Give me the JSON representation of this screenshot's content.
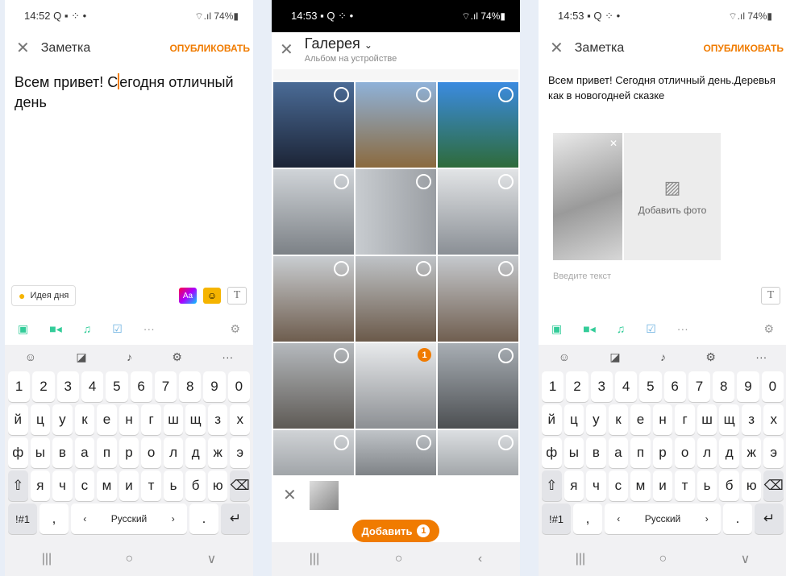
{
  "screens": [
    {
      "status_time": "14:52",
      "status_icons": "Q ▪ ⁘ •",
      "battery": "74%",
      "title": "Заметка",
      "publish": "ОПУБЛИКОВАТЬ",
      "note_before_caret": "Всем привет! С",
      "note_after_caret": "егодня отличный день"
    },
    {
      "status_time": "14:53",
      "status_icons": "▪ Q ⁘ •",
      "battery": "74%",
      "gallery_title": "Галерея",
      "gallery_sub": "Альбом на устройстве",
      "selected_count": "1",
      "add_button": "Добавить"
    },
    {
      "status_time": "14:53",
      "status_icons": "▪ Q ⁘ •",
      "battery": "74%",
      "title": "Заметка",
      "publish": "ОПУБЛИКОВАТЬ",
      "note": "Всем привет! Сегодня отличный день.Деревья как в новогодней сказке",
      "add_photo": "Добавить фото",
      "placeholder": "Введите текст"
    }
  ],
  "idea": "Идея дня",
  "aa_label": "Aa",
  "t_label": "T",
  "keyboard": {
    "numbers": [
      "1",
      "2",
      "3",
      "4",
      "5",
      "6",
      "7",
      "8",
      "9",
      "0"
    ],
    "row1": [
      "й",
      "ц",
      "у",
      "к",
      "е",
      "н",
      "г",
      "ш",
      "щ",
      "з",
      "х"
    ],
    "row2": [
      "ф",
      "ы",
      "в",
      "а",
      "п",
      "р",
      "о",
      "л",
      "д",
      "ж",
      "э"
    ],
    "row3": [
      "я",
      "ч",
      "с",
      "м",
      "и",
      "т",
      "ь",
      "б",
      "ю"
    ],
    "sym": "!#1",
    "comma": ",",
    "lang": "Русский",
    "dot": "."
  },
  "gallery_colors": [
    "#3b4a6b",
    "#6a8fb5",
    "#4d8fd1",
    "#cfd5db",
    "#b9bec4",
    "#d9dde0",
    "#c5c9cd",
    "#bfc3c7",
    "#c9cdd1",
    "#b5b9bd",
    "#e2e4e6",
    "#a8aeb4",
    "#d0d3d6",
    "#c0c4c8",
    "#dcdfe2"
  ]
}
